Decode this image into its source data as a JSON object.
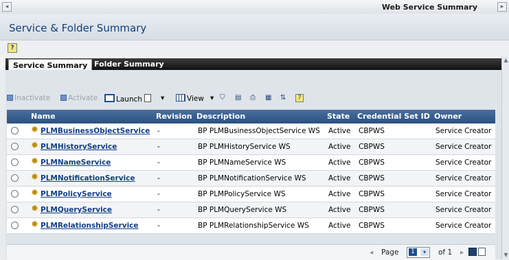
{
  "window": {
    "title": "Web Service Summary",
    "back_glyph": "◂",
    "forward_glyph": "▸"
  },
  "page": {
    "title": "Service & Folder Summary"
  },
  "help": {
    "glyph": "?"
  },
  "tabs": [
    {
      "label": "Service Summary",
      "active": true
    },
    {
      "label": "Folder Summary",
      "active": false
    }
  ],
  "toolbar": {
    "inactivate": "Inactivate",
    "activate": "Activate",
    "launch": "Launch",
    "view": "View",
    "dropdown_glyph": "▾",
    "help_glyph": "?"
  },
  "table": {
    "headers": [
      "Name",
      "Revision",
      "Description",
      "State",
      "Credential Set ID",
      "Owner"
    ],
    "rows": [
      {
        "name": "PLMBusinessObjectService",
        "revision": "-",
        "description": "BP PLMBusinessObjectService WS",
        "state": "Active",
        "credential": "CBPWS",
        "owner": "Service Creator"
      },
      {
        "name": "PLMHistoryService",
        "revision": "-",
        "description": "BP PLMHistoryService WS",
        "state": "Active",
        "credential": "CBPWS",
        "owner": "Service Creator"
      },
      {
        "name": "PLMNameService",
        "revision": "-",
        "description": "BP PLMNameService WS",
        "state": "Active",
        "credential": "CBPWS",
        "owner": "Service Creator"
      },
      {
        "name": "PLMNotificationService",
        "revision": "-",
        "description": "BP PLMNotificationService WS",
        "state": "Active",
        "credential": "CBPWS",
        "owner": "Service Creator"
      },
      {
        "name": "PLMPolicyService",
        "revision": "-",
        "description": "BP PLMPolicyService WS",
        "state": "Active",
        "credential": "CBPWS",
        "owner": "Service Creator"
      },
      {
        "name": "PLMQueryService",
        "revision": "-",
        "description": "BP PLMQueryService WS",
        "state": "Active",
        "credential": "CBPWS",
        "owner": "Service Creator"
      },
      {
        "name": "PLMRelationshipService",
        "revision": "-",
        "description": "BP PLMRelationshipService WS",
        "state": "Active",
        "credential": "CBPWS",
        "owner": "Service Creator"
      }
    ]
  },
  "pager": {
    "page_label": "Page",
    "current_page": "1",
    "of_label": "of 1"
  },
  "colors": {
    "header_bg": "#2a5181",
    "link": "#123f86",
    "title": "#123f77"
  }
}
